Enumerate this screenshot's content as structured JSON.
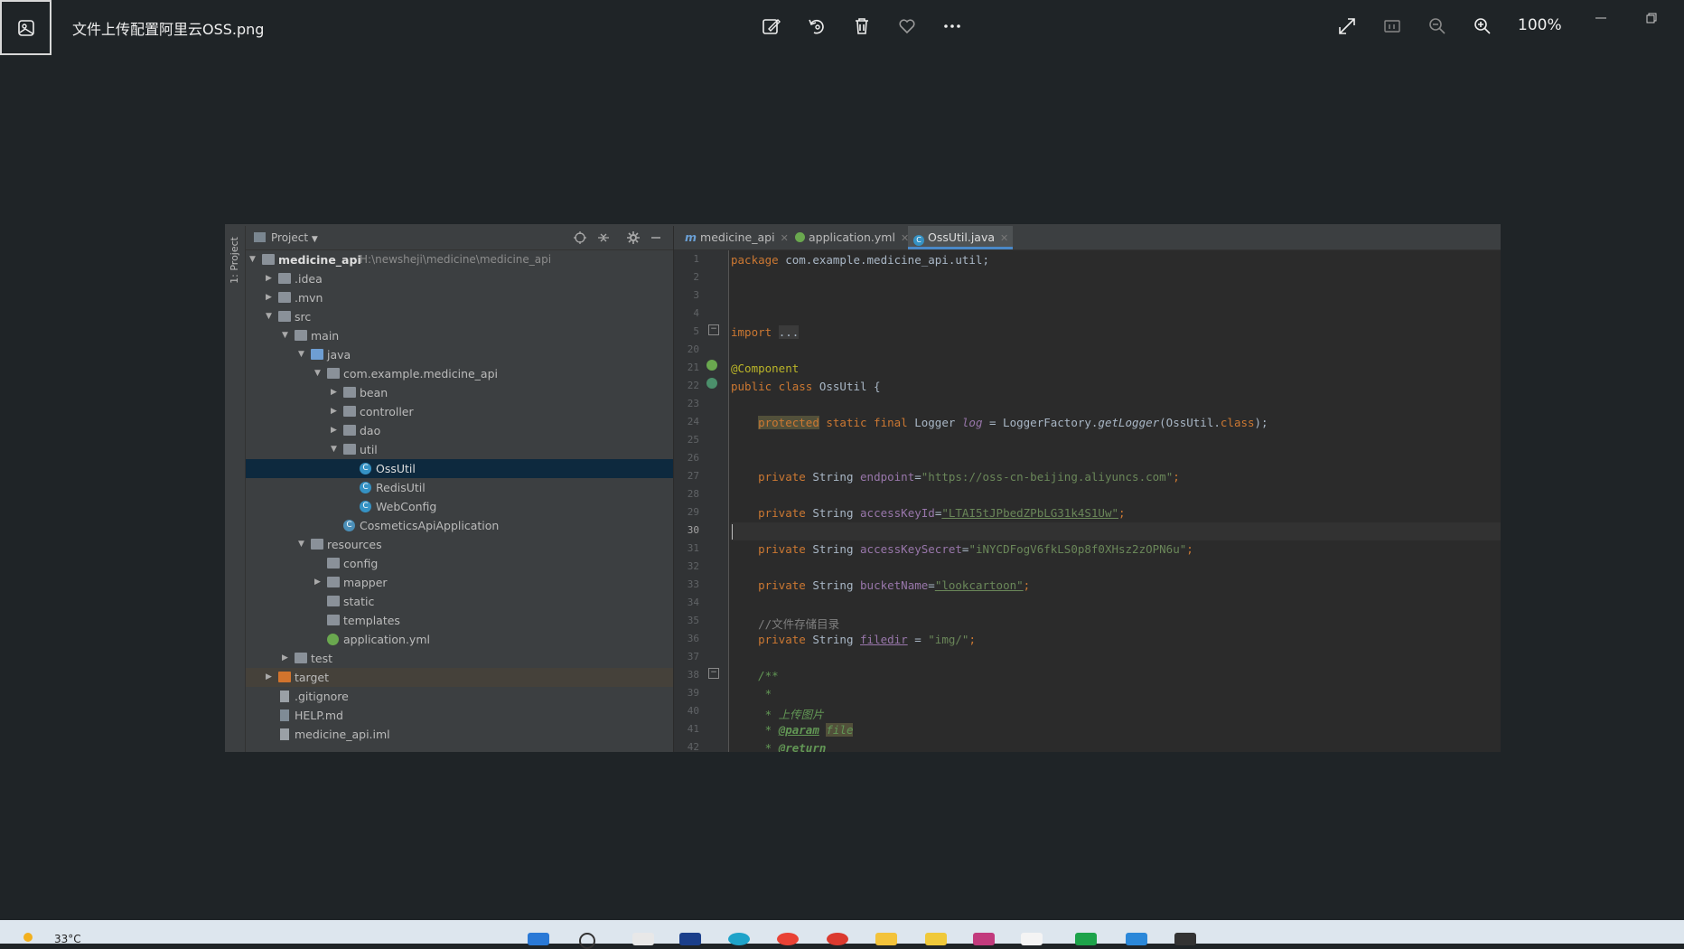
{
  "viewer": {
    "file_title": "文件上传配置阿里云OSS.png",
    "zoom": "100%",
    "toolbar_icons": [
      "edit-image-icon",
      "rotate-icon",
      "delete-icon",
      "favorite-icon",
      "more-icon"
    ],
    "right_icons": [
      "fullscreen-icon",
      "actual-size-icon",
      "zoom-out-icon",
      "zoom-in-icon"
    ]
  },
  "ide": {
    "side_label": "1: Project",
    "project_header": "Project",
    "tree": [
      {
        "label": "medicine_api",
        "path": "H:\\newsheji\\medicine\\medicine_api",
        "bold": true
      },
      {
        "label": ".idea"
      },
      {
        "label": ".mvn"
      },
      {
        "label": "src"
      },
      {
        "label": "main"
      },
      {
        "label": "java"
      },
      {
        "label": "com.example.medicine_api"
      },
      {
        "label": "bean"
      },
      {
        "label": "controller"
      },
      {
        "label": "dao"
      },
      {
        "label": "util"
      },
      {
        "label": "OssUtil"
      },
      {
        "label": "RedisUtil"
      },
      {
        "label": "WebConfig"
      },
      {
        "label": "CosmeticsApiApplication"
      },
      {
        "label": "resources"
      },
      {
        "label": "config"
      },
      {
        "label": "mapper"
      },
      {
        "label": "static"
      },
      {
        "label": "templates"
      },
      {
        "label": "application.yml"
      },
      {
        "label": "test"
      },
      {
        "label": "target"
      },
      {
        "label": ".gitignore"
      },
      {
        "label": "HELP.md"
      },
      {
        "label": "medicine_api.iml"
      }
    ],
    "tabs": [
      {
        "label": "medicine_api",
        "prefix": "m"
      },
      {
        "label": "application.yml"
      },
      {
        "label": "OssUtil.java",
        "active": true
      }
    ],
    "line_numbers": [
      "1",
      "2",
      "3",
      "4",
      "5",
      "20",
      "21",
      "22",
      "23",
      "24",
      "25",
      "26",
      "27",
      "28",
      "29",
      "30",
      "31",
      "32",
      "33",
      "34",
      "35",
      "36",
      "37",
      "38",
      "39",
      "40",
      "41",
      "42"
    ],
    "code": {
      "package": "package",
      "package_name": " com.example.medicine_api.util;",
      "import": "import",
      "import_fold": "...",
      "component": "@Component",
      "class_decl_kw": "public class",
      "class_decl_rest": " OssUtil {",
      "protected": "protected",
      "logger_kw": " static final",
      "logger_type": " Logger ",
      "logger_field": "log",
      "logger_eq": " = LoggerFactory.",
      "logger_call": "getLogger",
      "logger_arg": "(OssUtil.",
      "logger_class": "class",
      "logger_end": ");",
      "private": "private",
      "string_type": " String ",
      "endpoint_name": "endpoint",
      "endpoint_value": "\"https://oss-cn-beijing.aliyuncs.com\"",
      "access_key_id_name": "accessKeyId",
      "access_key_id_value": "\"LTAI5tJPbedZPbLG31k4S1Uw\"",
      "access_key_secret_name": "accessKeySecret",
      "access_key_secret_value": "\"iNYCDFogV6fkLS0p8f0XHsz2zOPN6u\"",
      "bucket_name": "bucketName",
      "bucket_value": "\"lookcartoon\"",
      "comment_dir": "//文件存储目录",
      "filedir_name": "filedir",
      "filedir_value": "\"img/\"",
      "doc_open": "/**",
      "doc_star": " *",
      "doc_upload": " * 上传图片",
      "doc_param_tag": "@param",
      "doc_param_name": "file",
      "doc_return_tag": "@return",
      "eq": "=",
      "semi": ";",
      "eq_sp": " = "
    }
  },
  "taskbar": {
    "temperature": "33°C"
  }
}
